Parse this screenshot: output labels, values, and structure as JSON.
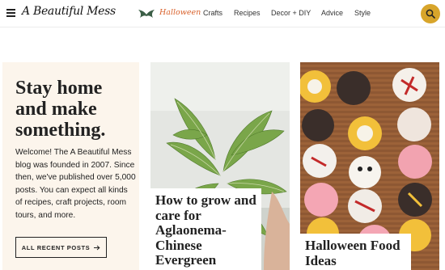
{
  "header": {
    "logo_text": "A Beautiful Mess",
    "nav": [
      {
        "label": "Halloween"
      },
      {
        "label": "Crafts"
      },
      {
        "label": "Recipes"
      },
      {
        "label": "Decor + DIY"
      },
      {
        "label": "Advice"
      },
      {
        "label": "Style"
      }
    ],
    "accent_color": "#d8a52b",
    "halloween_color": "#d9612b"
  },
  "intro": {
    "heading": "Stay home and make something.",
    "body": "Welcome! The A Beautiful Mess blog was founded in 2007. Since then, we've published over 5,000 posts. You can expect all kinds of recipes, craft projects, room tours, and more.",
    "button_label": "ALL RECENT POSTS",
    "background": "#fcf5ec"
  },
  "posts": [
    {
      "title": "How to grow and care for Aglaonema-Chinese Evergreen"
    },
    {
      "title": "Halloween Food Ideas"
    }
  ]
}
